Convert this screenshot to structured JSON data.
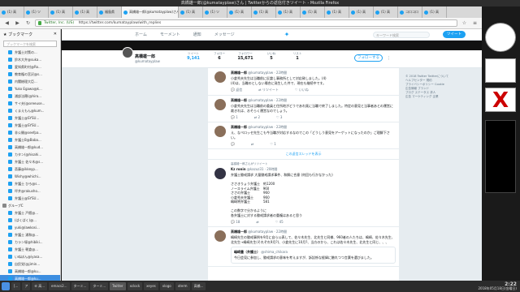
{
  "window": {
    "title": "高橋雄一郎(@kumatayplaw)さん | Twitterからの返信付きツイート - Mozilla Firefox"
  },
  "tabs": [
    {
      "label": "(1) 高"
    },
    {
      "label": "(1) ツ"
    },
    {
      "label": "(1) 高"
    },
    {
      "label": "(1) 高"
    },
    {
      "label": "福島県"
    },
    {
      "label": "高橋雄一郎(@kumatayplaw)さん",
      "active": true
    },
    {
      "label": "(1) 高"
    },
    {
      "label": "(1) ツ"
    },
    {
      "label": "(1) 高"
    },
    {
      "label": "(1) 高"
    },
    {
      "label": "(1) 高"
    },
    {
      "label": "(1) 高"
    },
    {
      "label": "(1) 高"
    },
    {
      "label": "(1) 高"
    },
    {
      "label": "(1) 高"
    },
    {
      "label": "コロコロ"
    },
    {
      "label": "(1) 高"
    }
  ],
  "nav": {
    "url": "https://twitter.com/kumatayplaw/with_replies",
    "secure_label": "Twitter, Inc. (US)"
  },
  "sidebar": {
    "title": "ブックマーク",
    "search_placeholder": "ブックマークを検索",
    "items": [
      {
        "label": "弁護士対策の..."
      },
      {
        "label": "鈴木大弁@suka..."
      },
      {
        "label": "愛知県町村@Ro..."
      },
      {
        "label": "教育権の宮沢@s..."
      },
      {
        "label": "内閣総理大臣..."
      },
      {
        "label": "Yuko Egawa@k..."
      },
      {
        "label": "浦部法穂(@hiro..."
      },
      {
        "label": "サイ夫(@oreeuse..."
      },
      {
        "label": "くまえもん@kum..."
      },
      {
        "label": "弁護士@SYSU..."
      },
      {
        "label": "弁護士@SYSU..."
      },
      {
        "label": "非公開@seefpa..."
      },
      {
        "label": "弁護士B@Baba..."
      },
      {
        "label": "高橋雄一郎@kud..."
      },
      {
        "label": "カタン(@hisahi..."
      },
      {
        "label": "弁護士 佐々木@s..."
      },
      {
        "label": "斎藤@ikkeyp..."
      },
      {
        "label": "Wishy@whichi..."
      },
      {
        "label": "弁護士 ひろ@s..."
      },
      {
        "label": "坪井@rakusho..."
      },
      {
        "label": "弁護士@SYSU..."
      },
      {
        "label": "グループC",
        "folder": true
      },
      {
        "label": "弁護士 戸館@..."
      },
      {
        "label": "(ぱくぱく)@..."
      },
      {
        "label": "yuki@lawkosi..."
      },
      {
        "label": "弁護士 浦和@..."
      },
      {
        "label": "カラン塚@hibiki..."
      },
      {
        "label": "弁護士 朝倉@..."
      },
      {
        "label": "いぬぼん@iyasa..."
      },
      {
        "label": "自民党(@jimin..."
      },
      {
        "label": "高橋雄一郎@ku..."
      },
      {
        "label": "高橋雄一郎@ku...",
        "selected": true
      },
      {
        "label": "これが一番す..."
      },
      {
        "label": "その他のブック..."
      }
    ]
  },
  "twitter_nav": {
    "home": "ホーム",
    "moments": "モーメント",
    "notifications": "通知",
    "messages": "メッセージ",
    "search_placeholder": "キーワード検索",
    "tweet_button": "ツイート"
  },
  "profile": {
    "name": "高橋雄一郎",
    "handle": "@kumatayplaw",
    "stats": [
      {
        "label": "ツイート",
        "value": "9,141",
        "active": true
      },
      {
        "label": "フォロー",
        "value": "6"
      },
      {
        "label": "フォロワー",
        "value": "15,671"
      },
      {
        "label": "いいね",
        "value": "5"
      },
      {
        "label": "リスト",
        "value": "1"
      }
    ],
    "follow_label": "フォローする",
    "more_label": "⋮"
  },
  "tweets": [
    {
      "name": "高橋雄一郎",
      "meta": "@kumatayplaw · 22時間",
      "text": "小倉秀夫先生は当職前に反論し事務所として対応致しました。(4)\n(4)は、当職のとしない場合に発生した件で、現在も継続中です。",
      "actions": [
        "返信",
        "リツイート",
        "いいね"
      ]
    },
    {
      "name": "高橋雄一郎",
      "meta": "@kumatayplaw · 22時間",
      "text": "小倉秀夫先生は当職前の委員と住所地がどうであれ既に当職で終了しました。特定の意見と当事者あとの運営に裁きれは、おそらく運営なのでしょう。",
      "actions": [
        "1",
        "2",
        "3"
      ]
    },
    {
      "name": "高橋雄一郎",
      "meta": "@kumatayplaw · 22時間",
      "text": "え、なぺロッセ先生こも今当職が対応するなのでこの「どうしう意見をアーゲットになったのか」ご理解下さい。",
      "actions": [
        "",
        "",
        "1"
      ]
    }
  ],
  "show_more": "この返信スレッドを表示",
  "retweet": {
    "context": "高橋雄一郎さんがリツイート",
    "name": "Kz ronin",
    "meta": "@kazuz31 · 20時間",
    "text": "弁護士懲戒請求 大量懲戒請求事件、和解に合意 (何回も行かなかった)\n\nささきりょう弁護士　約1200\nノースライム弁護士　960\nささの弁護士　　　　960\n小倉秀夫弁護士　　　960\n嶋崎将弁護士　　　　581\n\nこの数字で分かるように\n各弁護士に対する懲戒請求者の重複はあると思う",
    "actions": [
      "18",
      "",
      "45"
    ]
  },
  "final_tweet": {
    "name": "高橋雄一郎",
    "meta": "@kumatayplaw · 22時間",
    "text": "嶋崎先生の懲戒事例を9月に自ら公表して、佐々木先生、北先生と同様、960者の人たちは、嶋崎、佐々木先生、北先生→嶋崎先生(それぞれ9月?)、小倉先生に10月?、当方のから、これは佐々木先生、北先生と同じ、、、",
    "quote_name": "嶋崎量（弁護士）",
    "quote_handle": "@shima_chikara",
    "quote_text": "今日会見に参加し、懲戒請求の意味を考えますが、訴訟係な経緯に触れつつ言葉を選びました。"
  },
  "right_card": "© 2018 Twitter  Twitterについて\nヘルプセンター  規約\nプライバシーポリシー  Cookie\n広告情報  ブランド\nブログ  ステータス  求人\n広告  マーケティング  企業",
  "taskbar": {
    "items": [
      {
        "label": "[..."
      },
      {
        "label": "ア"
      },
      {
        "label": "⑥ 高..."
      },
      {
        "label": "emacs2..."
      },
      {
        "label": "ターミ..."
      },
      {
        "label": "ターミ..."
      },
      {
        "label": "Twitter",
        "active": true
      },
      {
        "label": "xclock"
      },
      {
        "label": "xeyes"
      },
      {
        "label": "xlogo"
      },
      {
        "label": "xterm"
      },
      {
        "label": "高橋..."
      }
    ],
    "time": "2:22",
    "date": "2018年05月18日(金曜日)"
  }
}
